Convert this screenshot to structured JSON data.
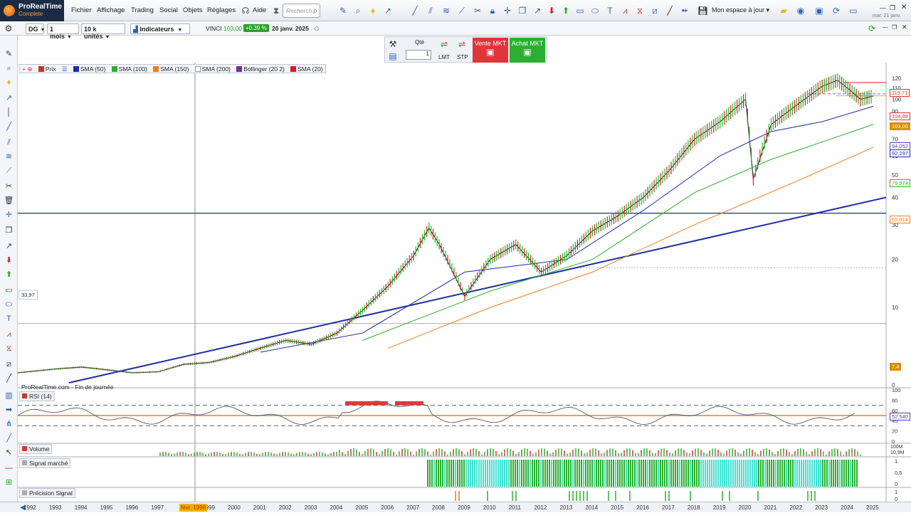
{
  "app": {
    "name": "ProRealTime",
    "edition": "Complete"
  },
  "menu": [
    "Fichier",
    "Affichage",
    "Trading",
    "Social",
    "Objets",
    "Réglages",
    "Aide"
  ],
  "search": {
    "placeholder": "Recherch"
  },
  "workspace": "Mon espace à jour",
  "top_date": "mar. 21 janv.",
  "toolbar2": {
    "symbol_code": "DG",
    "period": "1 mois",
    "units": "10 k unités",
    "indicators_label": "Indicateurs",
    "instrument": "VINCI",
    "last_price": "103,00",
    "change": "+0.39 %",
    "date": "20 janv. 2025"
  },
  "order": {
    "qty_label": "Qté",
    "qty_value": "1",
    "lmt": "LMT",
    "stp": "STP",
    "sell_label": "Vente MKT",
    "buy_label": "Achat MKT"
  },
  "legend": [
    {
      "label": "Prix",
      "color": "#c0392b"
    },
    {
      "label": "SMA (50)",
      "color": "#1c2ea0"
    },
    {
      "label": "SMA (100)",
      "color": "#2ab02a"
    },
    {
      "label": "SMA (150)",
      "color": "#f07b1e"
    },
    {
      "label": "SMA (200)",
      "color": "#ffffff"
    },
    {
      "label": "Bollinger (20 2)",
      "color": "#7a2a9a"
    },
    {
      "label": "SMA (20)",
      "color": "#e0182a"
    }
  ],
  "panels": {
    "footer_note": "ProRealTime.com - Fin de journée",
    "rsi": "RSI (14)",
    "volume": "Volume",
    "signal": "Signal marché",
    "precision": "Précision Signal"
  },
  "price_axis": [
    "120",
    "110",
    "100",
    "90",
    "80",
    "70",
    "60",
    "50",
    "40",
    "30",
    "20",
    "10",
    "0"
  ],
  "price_tags": [
    {
      "label": "115,71",
      "color": "#d33"
    },
    {
      "label": "104,88",
      "color": "#d33"
    },
    {
      "label": "103,00",
      "color": "#d88e00"
    },
    {
      "label": "94,052",
      "color": "#5a3ab0"
    },
    {
      "label": "92,297",
      "color": "#1c2ea0"
    },
    {
      "label": "79,974",
      "color": "#2ab02a"
    },
    {
      "label": "65,614",
      "color": "#f07b1e"
    },
    {
      "label": "7,4",
      "color": "#d88e00"
    }
  ],
  "horizontal_line_label": "33,97",
  "rsi_axis": [
    "100",
    "80",
    "60",
    "40",
    "20",
    "0"
  ],
  "rsi_value": "52,540",
  "volume_axis": [
    "100M",
    "10,9M"
  ],
  "signal_axis": [
    "1",
    "0,5",
    "0"
  ],
  "precision_axis": [
    "1",
    "0"
  ],
  "crosshair_date": "févr. 1998",
  "years": [
    "1992",
    "1993",
    "1994",
    "1995",
    "1996",
    "1997",
    "1999",
    "2000",
    "2001",
    "2002",
    "2003",
    "2004",
    "2005",
    "2006",
    "2007",
    "2008",
    "2009",
    "2010",
    "2011",
    "2012",
    "2013",
    "2014",
    "2015",
    "2016",
    "2017",
    "2018",
    "2019",
    "2020",
    "2021",
    "2022",
    "2023",
    "2024",
    "2025"
  ],
  "chart_data": {
    "type": "line",
    "title": "VINCI",
    "timeframe": "1 mois",
    "series": [
      {
        "name": "Prix",
        "points": [
          [
            1991.5,
            1.2
          ],
          [
            1993,
            1.6
          ],
          [
            1994,
            1.8
          ],
          [
            1995,
            1.5
          ],
          [
            1996,
            1.2
          ],
          [
            1997,
            1.3
          ],
          [
            1998,
            2.1
          ],
          [
            1999,
            2.3
          ],
          [
            2000,
            3.0
          ],
          [
            2001,
            4.0
          ],
          [
            2002,
            5.0
          ],
          [
            2003,
            4.5
          ],
          [
            2004,
            6.0
          ],
          [
            2005,
            9.5
          ],
          [
            2006,
            14
          ],
          [
            2007,
            21
          ],
          [
            2007.6,
            29
          ],
          [
            2008,
            24
          ],
          [
            2009,
            12
          ],
          [
            2010,
            20
          ],
          [
            2011,
            24
          ],
          [
            2012,
            17
          ],
          [
            2013,
            21
          ],
          [
            2014,
            28
          ],
          [
            2015,
            33
          ],
          [
            2016,
            40
          ],
          [
            2017,
            52
          ],
          [
            2018,
            70
          ],
          [
            2019,
            82
          ],
          [
            2020,
            100
          ],
          [
            2020.3,
            48
          ],
          [
            2021,
            80
          ],
          [
            2022,
            95
          ],
          [
            2023,
            112
          ],
          [
            2023.6,
            118
          ],
          [
            2024,
            110
          ],
          [
            2024.5,
            100
          ],
          [
            2025,
            103
          ]
        ]
      },
      {
        "name": "SMA (50)",
        "points": [
          [
            2001,
            3.5
          ],
          [
            2005,
            6
          ],
          [
            2009,
            17
          ],
          [
            2013,
            20
          ],
          [
            2016,
            35
          ],
          [
            2019,
            60
          ],
          [
            2021,
            75
          ],
          [
            2023,
            82
          ],
          [
            2025,
            94
          ]
        ]
      },
      {
        "name": "SMA (100)",
        "points": [
          [
            2005,
            5
          ],
          [
            2010,
            13
          ],
          [
            2014,
            20
          ],
          [
            2018,
            42
          ],
          [
            2021,
            58
          ],
          [
            2025,
            80
          ]
        ]
      },
      {
        "name": "SMA (150)",
        "points": [
          [
            2006,
            4
          ],
          [
            2010,
            10
          ],
          [
            2014,
            17
          ],
          [
            2018,
            30
          ],
          [
            2022,
            47
          ],
          [
            2025,
            65
          ]
        ]
      }
    ],
    "xlim": [
      1991.5,
      2025.5
    ],
    "ylim": [
      0,
      125
    ],
    "horizontal_line": 33.97,
    "last_price": 103.0,
    "rsi_last": 52.54,
    "rsi_levels": [
      70,
      50,
      30
    ]
  }
}
